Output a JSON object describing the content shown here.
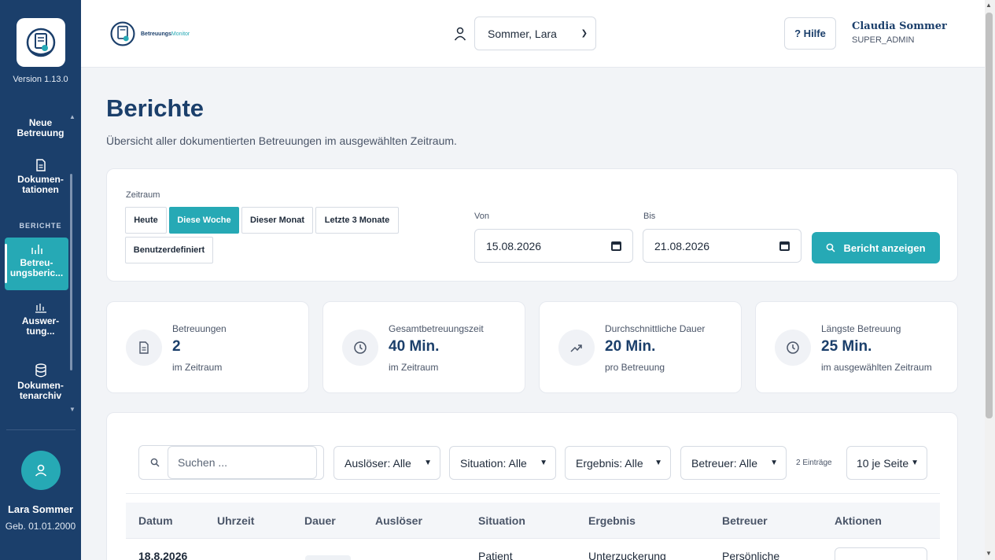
{
  "app": {
    "version": "Version 1.13.0",
    "logo_text_a": "Betreuungs",
    "logo_text_b": "Monitor",
    "accent": "#26a9b5",
    "brand": "#1b3f6b"
  },
  "sidebar": {
    "neue": "Neue Betreuung",
    "dokumentationen": "Dokumen-tationen",
    "section": "BERICHTE",
    "active_item": "Betreu-ungsberic...",
    "auswertung": "Auswer-tung...",
    "archiv": "Dokumen-tenarchiv",
    "user_name": "Lara Sommer",
    "user_birth": "Geb. 01.01.2000"
  },
  "header": {
    "patient_select": "Sommer, Lara",
    "help": "? Hilfe",
    "user_name": "Claudia Sommer",
    "user_role": "SUPER_ADMIN"
  },
  "page": {
    "title": "Berichte",
    "subtitle": "Übersicht aller dokumentierten Betreuungen im ausgewählten Zeitraum."
  },
  "filter": {
    "zeitraum_label": "Zeitraum",
    "buttons": [
      "Heute",
      "Diese Woche",
      "Dieser Monat",
      "Letzte 3 Monate",
      "Benutzerdefiniert"
    ],
    "active": "Diese Woche",
    "von_label": "Von",
    "von_value": "15.08.2026",
    "bis_label": "Bis",
    "bis_value": "21.08.2026",
    "submit": "Bericht anzeigen"
  },
  "stats": [
    {
      "label": "Betreuungen",
      "value": "2",
      "sub": "im Zeitraum",
      "icon": "document-icon"
    },
    {
      "label": "Gesamtbetreuungszeit",
      "value": "40 Min.",
      "sub": "im Zeitraum",
      "icon": "clock-icon"
    },
    {
      "label": "Durchschnittliche Dauer",
      "value": "20 Min.",
      "sub": "pro Betreuung",
      "icon": "trend-icon"
    },
    {
      "label": "Längste Betreuung",
      "value": "25 Min.",
      "sub": "im ausgewählten Zeitraum",
      "icon": "clock-icon"
    }
  ],
  "table": {
    "search_placeholder": "Suchen ...",
    "filters": [
      "Auslöser: Alle",
      "Situation: Alle",
      "Ergebnis: Alle",
      "Betreuer: Alle"
    ],
    "entries": "2 Einträge",
    "per_page": "10 je Seite",
    "headers": [
      "Datum",
      "Uhrzeit",
      "Dauer",
      "Auslöser",
      "Situation",
      "Ergebnis",
      "Betreuer",
      "Aktionen"
    ],
    "rows": [
      {
        "datum": "18.8.2026",
        "situation": "Patient",
        "ergebnis": "Unterzuckerung",
        "betreuer": "Persönliche"
      }
    ]
  }
}
